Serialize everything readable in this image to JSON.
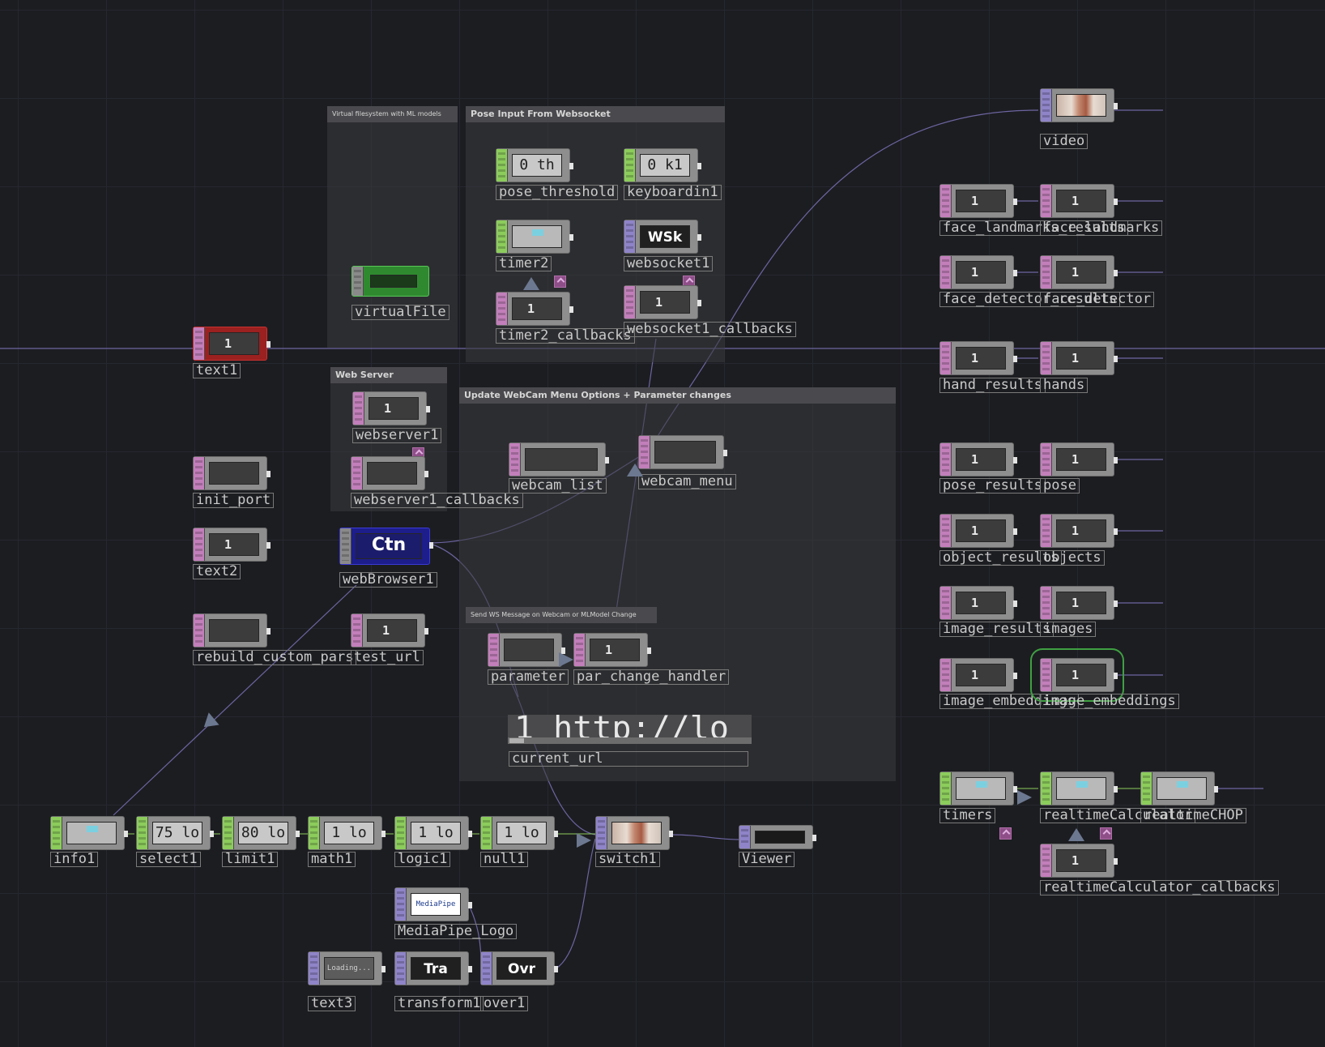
{
  "annotations": {
    "vfs": "Virtual filesystem with ML models",
    "pose_input": "Pose Input From Websocket",
    "web_server": "Web Server",
    "webcam_menu": "Update WebCam Menu Options + Parameter changes",
    "ws_message": "Send WS Message on Webcam or MLModel Change"
  },
  "nodes": {
    "video": {
      "label": "video"
    },
    "face_landmarks_result": {
      "label": "face_landmarks_results"
    },
    "face_landmarks": {
      "label": "face_landmarks"
    },
    "face_detector_result": {
      "label": "face_detector_results"
    },
    "face_detector": {
      "label": "face_detector"
    },
    "hand_result": {
      "label": "hand_results"
    },
    "hands": {
      "label": "hands"
    },
    "pose_result": {
      "label": "pose_results"
    },
    "pose": {
      "label": "pose"
    },
    "object_result": {
      "label": "object_results"
    },
    "objects": {
      "label": "objects"
    },
    "image_result": {
      "label": "image_results"
    },
    "images": {
      "label": "images"
    },
    "image_embed": {
      "label": "image_embeddings"
    },
    "image_embeddings": {
      "label": "image_embeddings"
    },
    "timers": {
      "label": "timers"
    },
    "realtimeCalculator": {
      "label": "realtimeCalculator"
    },
    "realtimeCHOP": {
      "label": "realtimeCHOP"
    },
    "realtimeCalculator_callback": {
      "label": "realtimeCalculator_callbacks"
    },
    "pose_threshold": {
      "label": "pose_threshold",
      "value": "0 th"
    },
    "keyboardin1": {
      "label": "keyboardin1",
      "value": "0 k1"
    },
    "timer2": {
      "label": "timer2"
    },
    "websocket1": {
      "label": "websocket1",
      "value": "WSk"
    },
    "timer2_callbacks": {
      "label": "timer2_callbacks"
    },
    "websocket1_callbacks": {
      "label": "websocket1_callbacks"
    },
    "virtualFile": {
      "label": "virtualFile"
    },
    "text1": {
      "label": "text1"
    },
    "webserver1": {
      "label": "webserver1"
    },
    "webserver1_callbacks": {
      "label": "webserver1_callbacks"
    },
    "init_port": {
      "label": "init_port"
    },
    "text2": {
      "label": "text2"
    },
    "webBrowser1": {
      "label": "webBrowser1",
      "value": "Ctn"
    },
    "rebuild_custom_pars": {
      "label": "rebuild_custom_pars"
    },
    "test_url": {
      "label": "test_url"
    },
    "webcam_list": {
      "label": "webcam_list"
    },
    "webcam_menu": {
      "label": "webcam_menu"
    },
    "parameter": {
      "label": "parameter"
    },
    "par_change_handler": {
      "label": "par_change_handler"
    },
    "current_url": {
      "label": "current_url",
      "value": "1 http://lo"
    },
    "info1": {
      "label": "info1"
    },
    "select1": {
      "label": "select1",
      "value": "75 lo"
    },
    "limit1": {
      "label": "limit1",
      "value": "80 lo"
    },
    "math1": {
      "label": "math1",
      "value": "1 lo"
    },
    "logic1": {
      "label": "logic1",
      "value": "1 lo"
    },
    "null1": {
      "label": "null1",
      "value": "1 lo"
    },
    "switch1": {
      "label": "switch1"
    },
    "Viewer": {
      "label": "Viewer"
    },
    "MediaPipe_Logo": {
      "label": "MediaPipe_Logo",
      "value": "MediaPipe"
    },
    "text3": {
      "label": "text3",
      "value": "Loading..."
    },
    "transform1": {
      "label": "transform1",
      "value": "Tra"
    },
    "over1": {
      "label": "over1",
      "value": "Ovr"
    }
  },
  "glyphs": {
    "dat_script": "1"
  },
  "colors": {
    "background": "#1c1d21",
    "dat_strip": "#c27fba",
    "chop_strip": "#8ccc5c",
    "top_strip": "#8f84c8",
    "wire": "#7a72b8",
    "selected": "#3fa042"
  }
}
